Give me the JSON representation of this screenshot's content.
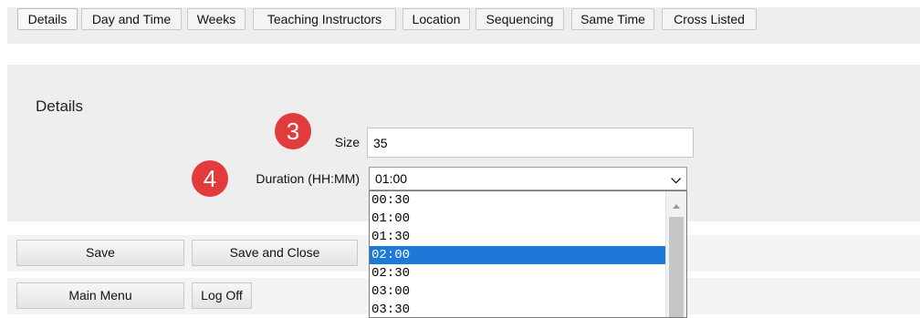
{
  "tabs": [
    "Details",
    "Day and Time",
    "Weeks",
    "Teaching Instructors",
    "Location",
    "Sequencing",
    "Same Time",
    "Cross Listed"
  ],
  "section": {
    "title": "Details"
  },
  "badges": {
    "size": "3",
    "duration": "4"
  },
  "size_field": {
    "label": "Size",
    "value": "35"
  },
  "duration_field": {
    "label": "Duration (HH:MM)",
    "selected": "01:00",
    "options": [
      "00:30",
      "01:00",
      "01:30",
      "02:00",
      "02:30",
      "03:00",
      "03:30"
    ],
    "highlighted": "02:00"
  },
  "buttons": {
    "save": "Save",
    "save_close": "Save and Close",
    "main_menu": "Main Menu",
    "log_off": "Log Off"
  },
  "colors": {
    "badge": "#e23b3b",
    "highlight": "#1e78d7",
    "panel": "#eeeeee"
  }
}
